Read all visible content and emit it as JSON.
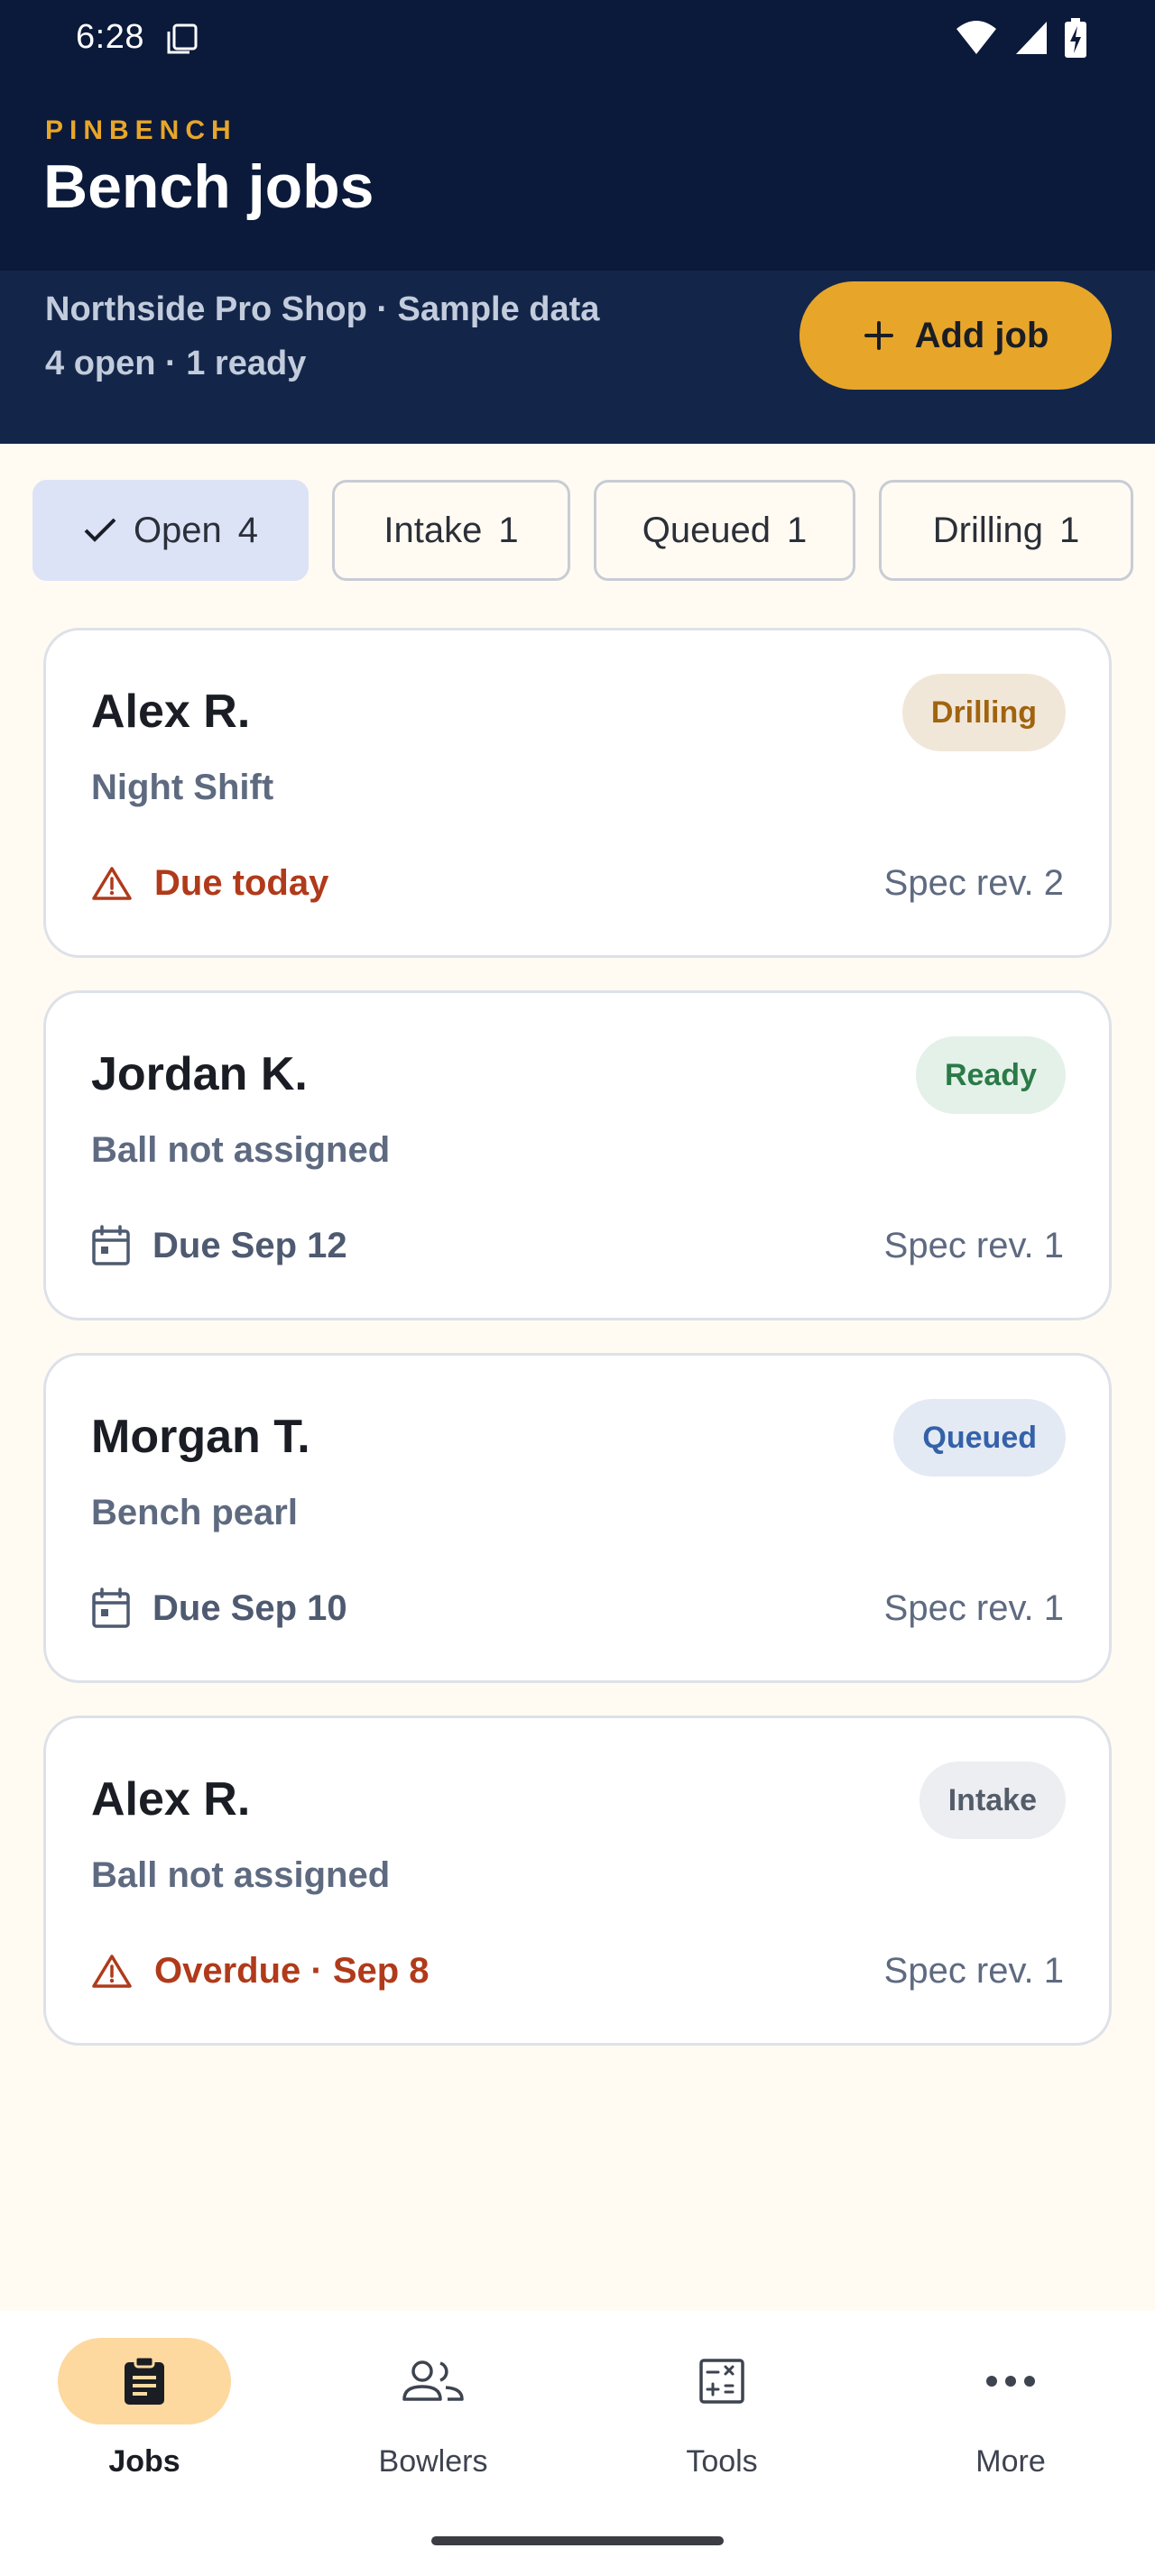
{
  "status_bar": {
    "time": "6:28"
  },
  "header": {
    "app_name": "PINBENCH",
    "title": "Bench jobs",
    "shop_line": "Northside Pro Shop · Sample data",
    "count_line": "4 open · 1 ready",
    "add_job_label": "Add job"
  },
  "filters": [
    {
      "label": "Open",
      "count": "4",
      "selected": true
    },
    {
      "label": "Intake",
      "count": "1",
      "selected": false
    },
    {
      "label": "Queued",
      "count": "1",
      "selected": false
    },
    {
      "label": "Drilling",
      "count": "1",
      "selected": false
    }
  ],
  "jobs": [
    {
      "name": "Alex R.",
      "status": "Drilling",
      "ball": "Night Shift",
      "due": "Due today",
      "due_icon": "warning-icon",
      "spec": "Spec rev. 2",
      "colors": {
        "badge_bg": "#F1E7D9",
        "badge_fg": "#A0640F",
        "due": "#B03A1A"
      }
    },
    {
      "name": "Jordan K.",
      "status": "Ready",
      "ball": "Ball not assigned",
      "due": "Due Sep 12",
      "due_icon": "calendar-icon",
      "spec": "Spec rev. 1",
      "colors": {
        "badge_bg": "#E3F1E8",
        "badge_fg": "#2B7A47",
        "due": "#4E5A70"
      }
    },
    {
      "name": "Morgan T.",
      "status": "Queued",
      "ball": "Bench pearl",
      "due": "Due Sep 10",
      "due_icon": "calendar-icon",
      "spec": "Spec rev. 1",
      "colors": {
        "badge_bg": "#E4EAF4",
        "badge_fg": "#3462A8",
        "due": "#4E5A70"
      }
    },
    {
      "name": "Alex R.",
      "status": "Intake",
      "ball": "Ball not assigned",
      "due": "Overdue · Sep 8",
      "due_icon": "warning-icon",
      "spec": "Spec rev. 1",
      "colors": {
        "badge_bg": "#ECEEF1",
        "badge_fg": "#545C6A",
        "due": "#B03A1A"
      }
    }
  ],
  "nav": [
    {
      "label": "Jobs",
      "icon": "clipboard-icon",
      "active": true
    },
    {
      "label": "Bowlers",
      "icon": "people-icon",
      "active": false
    },
    {
      "label": "Tools",
      "icon": "calculator-icon",
      "active": false
    },
    {
      "label": "More",
      "icon": "more-dots-icon",
      "active": false
    }
  ],
  "colors": {
    "header_bg": "#0B1A3A",
    "subheader_bg": "#13264A",
    "accent": "#E7A62A",
    "page_bg": "#FFFBF3",
    "chip_selected_bg": "#DCE3F7",
    "nav_active_bg": "#FDD9A0"
  }
}
